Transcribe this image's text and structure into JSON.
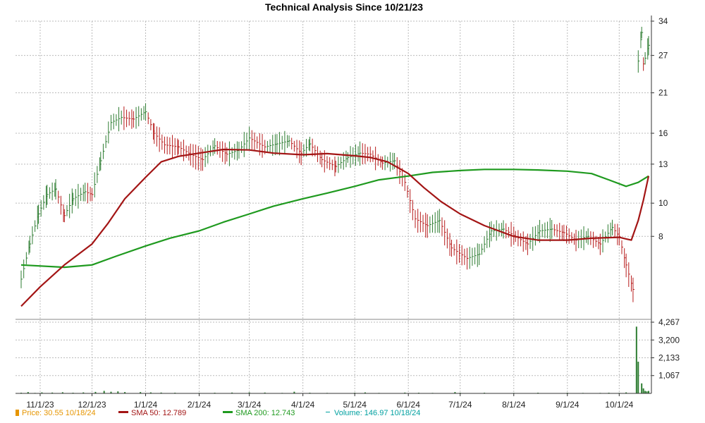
{
  "colors": {
    "price_up": "#2e7d32",
    "price_down": "#b71c1c",
    "sma50": "#a31515",
    "sma200": "#1f9a1f",
    "volume": "#2e7d32",
    "grid": "#bbbbbb",
    "legend_price": "#e69500",
    "legend_sma50": "#a31515",
    "legend_sma200": "#1f9a1f",
    "legend_volume": "#00a0a0"
  },
  "chart_data": {
    "type": "line",
    "title": "Technical Analysis Since 10/21/23",
    "x_tick_labels": [
      "11/1/23",
      "12/1/23",
      "1/1/24",
      "2/1/24",
      "3/1/24",
      "4/1/24",
      "5/1/24",
      "6/1/24",
      "7/1/24",
      "8/1/24",
      "9/1/24",
      "10/1/24"
    ],
    "x_ticks": [
      "2023-11-01",
      "2023-12-01",
      "2024-01-01",
      "2024-02-01",
      "2024-03-01",
      "2024-04-01",
      "2024-05-01",
      "2024-06-01",
      "2024-07-01",
      "2024-08-01",
      "2024-09-01",
      "2024-10-01"
    ],
    "x_range": [
      "2023-10-21",
      "2024-10-18"
    ],
    "price_axis": {
      "scale": "log",
      "ylim": [
        4.6,
        34
      ],
      "ticks": [
        8,
        10,
        13,
        16,
        21,
        27,
        34
      ],
      "position": "right"
    },
    "volume_axis": {
      "ylim": [
        0,
        4267
      ],
      "ticks": [
        1067,
        2133,
        3200,
        4267
      ],
      "tick_labels": [
        "1,067",
        "2,133",
        "3,200",
        "4,267"
      ],
      "position": "right"
    },
    "grid": true,
    "series": [
      {
        "name": "SMA 50",
        "points": [
          [
            "2023-10-21",
            5.0
          ],
          [
            "2023-11-01",
            5.7
          ],
          [
            "2023-11-15",
            6.6
          ],
          [
            "2023-12-01",
            7.6
          ],
          [
            "2023-12-10",
            8.7
          ],
          [
            "2023-12-20",
            10.3
          ],
          [
            "2024-01-01",
            11.9
          ],
          [
            "2024-01-10",
            13.2
          ],
          [
            "2024-01-20",
            13.7
          ],
          [
            "2024-02-01",
            14.0
          ],
          [
            "2024-02-15",
            14.35
          ],
          [
            "2024-03-01",
            14.3
          ],
          [
            "2024-03-15",
            14.0
          ],
          [
            "2024-04-01",
            13.85
          ],
          [
            "2024-04-15",
            13.95
          ],
          [
            "2024-05-01",
            13.75
          ],
          [
            "2024-05-10",
            13.6
          ],
          [
            "2024-05-20",
            13.2
          ],
          [
            "2024-06-01",
            12.2
          ],
          [
            "2024-06-10",
            11.1
          ],
          [
            "2024-06-20",
            10.1
          ],
          [
            "2024-07-01",
            9.3
          ],
          [
            "2024-07-15",
            8.6
          ],
          [
            "2024-08-01",
            8.0
          ],
          [
            "2024-08-15",
            7.8
          ],
          [
            "2024-09-01",
            7.8
          ],
          [
            "2024-09-15",
            7.9
          ],
          [
            "2024-10-01",
            7.95
          ],
          [
            "2024-10-08",
            7.8
          ],
          [
            "2024-10-12",
            8.9
          ],
          [
            "2024-10-15",
            10.2
          ],
          [
            "2024-10-18",
            12.0
          ]
        ]
      },
      {
        "name": "SMA 200",
        "points": [
          [
            "2023-10-21",
            6.6
          ],
          [
            "2023-11-15",
            6.5
          ],
          [
            "2023-12-01",
            6.6
          ],
          [
            "2023-12-15",
            7.0
          ],
          [
            "2024-01-01",
            7.5
          ],
          [
            "2024-01-15",
            7.9
          ],
          [
            "2024-02-01",
            8.3
          ],
          [
            "2024-02-15",
            8.8
          ],
          [
            "2024-03-01",
            9.3
          ],
          [
            "2024-03-15",
            9.8
          ],
          [
            "2024-04-01",
            10.3
          ],
          [
            "2024-04-15",
            10.7
          ],
          [
            "2024-05-01",
            11.2
          ],
          [
            "2024-05-15",
            11.7
          ],
          [
            "2024-06-01",
            12.0
          ],
          [
            "2024-06-15",
            12.3
          ],
          [
            "2024-07-01",
            12.45
          ],
          [
            "2024-07-15",
            12.55
          ],
          [
            "2024-08-01",
            12.55
          ],
          [
            "2024-08-15",
            12.5
          ],
          [
            "2024-09-01",
            12.4
          ],
          [
            "2024-09-15",
            12.2
          ],
          [
            "2024-09-25",
            11.7
          ],
          [
            "2024-10-05",
            11.2
          ],
          [
            "2024-10-12",
            11.5
          ],
          [
            "2024-10-18",
            12.0
          ]
        ]
      },
      {
        "name": "Price",
        "points": [
          [
            "2023-10-21",
            6.0
          ],
          [
            "2023-10-26",
            7.6
          ],
          [
            "2023-10-31",
            9.3
          ],
          [
            "2023-11-05",
            10.6
          ],
          [
            "2023-11-10",
            11.0
          ],
          [
            "2023-11-15",
            9.2
          ],
          [
            "2023-11-20",
            10.3
          ],
          [
            "2023-11-27",
            10.8
          ],
          [
            "2023-12-01",
            10.6
          ],
          [
            "2023-12-06",
            13.3
          ],
          [
            "2023-12-12",
            17.2
          ],
          [
            "2023-12-18",
            17.8
          ],
          [
            "2023-12-25",
            17.6
          ],
          [
            "2024-01-01",
            18.5
          ],
          [
            "2024-01-06",
            16.0
          ],
          [
            "2024-01-12",
            14.8
          ],
          [
            "2024-01-20",
            14.6
          ],
          [
            "2024-01-27",
            13.9
          ],
          [
            "2024-02-03",
            13.4
          ],
          [
            "2024-02-10",
            14.7
          ],
          [
            "2024-02-17",
            13.9
          ],
          [
            "2024-02-24",
            14.3
          ],
          [
            "2024-03-01",
            15.5
          ],
          [
            "2024-03-10",
            14.6
          ],
          [
            "2024-03-17",
            14.9
          ],
          [
            "2024-03-24",
            15.2
          ],
          [
            "2024-03-31",
            14.0
          ],
          [
            "2024-04-05",
            14.9
          ],
          [
            "2024-04-12",
            13.4
          ],
          [
            "2024-04-20",
            12.8
          ],
          [
            "2024-04-27",
            13.6
          ],
          [
            "2024-05-04",
            14.0
          ],
          [
            "2024-05-10",
            13.9
          ],
          [
            "2024-05-17",
            13.1
          ],
          [
            "2024-05-24",
            13.3
          ],
          [
            "2024-05-30",
            11.5
          ],
          [
            "2024-06-05",
            9.0
          ],
          [
            "2024-06-12",
            8.6
          ],
          [
            "2024-06-19",
            8.9
          ],
          [
            "2024-06-26",
            7.4
          ],
          [
            "2024-07-05",
            6.9
          ],
          [
            "2024-07-12",
            7.1
          ],
          [
            "2024-07-19",
            8.3
          ],
          [
            "2024-07-26",
            8.4
          ],
          [
            "2024-08-02",
            8.0
          ],
          [
            "2024-08-09",
            7.6
          ],
          [
            "2024-08-16",
            8.3
          ],
          [
            "2024-08-23",
            8.4
          ],
          [
            "2024-08-30",
            8.2
          ],
          [
            "2024-09-06",
            7.8
          ],
          [
            "2024-09-13",
            8.0
          ],
          [
            "2024-09-20",
            7.6
          ],
          [
            "2024-09-27",
            8.5
          ],
          [
            "2024-10-01",
            8.0
          ],
          [
            "2024-10-05",
            6.6
          ],
          [
            "2024-10-09",
            5.6
          ],
          [
            "2024-10-12",
            26.0
          ],
          [
            "2024-10-14",
            31.5
          ],
          [
            "2024-10-15",
            25.5
          ],
          [
            "2024-10-16",
            26.5
          ],
          [
            "2024-10-18",
            28.9
          ]
        ]
      }
    ],
    "volume": [
      [
        "2023-10-21",
        40
      ],
      [
        "2023-10-25",
        80
      ],
      [
        "2023-10-29",
        30
      ],
      [
        "2023-11-02",
        60
      ],
      [
        "2023-11-08",
        50
      ],
      [
        "2023-11-14",
        70
      ],
      [
        "2023-11-20",
        40
      ],
      [
        "2023-11-26",
        60
      ],
      [
        "2023-12-03",
        90
      ],
      [
        "2023-12-08",
        150
      ],
      [
        "2023-12-12",
        100
      ],
      [
        "2023-12-16",
        120
      ],
      [
        "2023-12-20",
        80
      ],
      [
        "2023-12-29",
        80
      ],
      [
        "2024-01-04",
        60
      ],
      [
        "2024-01-10",
        50
      ],
      [
        "2024-01-18",
        40
      ],
      [
        "2024-02-01",
        30
      ],
      [
        "2024-02-10",
        40
      ],
      [
        "2024-02-20",
        50
      ],
      [
        "2024-03-01",
        60
      ],
      [
        "2024-03-10",
        50
      ],
      [
        "2024-03-20",
        30
      ],
      [
        "2024-03-27",
        100
      ],
      [
        "2024-04-05",
        40
      ],
      [
        "2024-04-15",
        30
      ],
      [
        "2024-05-01",
        40
      ],
      [
        "2024-05-07",
        60
      ],
      [
        "2024-05-15",
        30
      ],
      [
        "2024-05-30",
        50
      ],
      [
        "2024-06-07",
        40
      ],
      [
        "2024-06-15",
        30
      ],
      [
        "2024-06-28",
        80
      ],
      [
        "2024-07-01",
        40
      ],
      [
        "2024-07-15",
        40
      ],
      [
        "2024-08-01",
        30
      ],
      [
        "2024-08-15",
        40
      ],
      [
        "2024-09-01",
        40
      ],
      [
        "2024-09-10",
        30
      ],
      [
        "2024-09-20",
        30
      ],
      [
        "2024-09-25",
        40
      ],
      [
        "2024-10-01",
        30
      ],
      [
        "2024-10-05",
        60
      ],
      [
        "2024-10-11",
        4000
      ],
      [
        "2024-10-12",
        1900
      ],
      [
        "2024-10-14",
        600
      ],
      [
        "2024-10-15",
        300
      ],
      [
        "2024-10-16",
        150
      ],
      [
        "2024-10-17",
        120
      ],
      [
        "2024-10-18",
        147
      ]
    ]
  },
  "legend": [
    {
      "key": "price",
      "label": "Price: 30.55  10/18/24"
    },
    {
      "key": "sma50",
      "label": "SMA 50: 12.789"
    },
    {
      "key": "sma200",
      "label": "SMA 200: 12.743"
    },
    {
      "key": "volume",
      "label": "Volume: 146.97  10/18/24"
    }
  ]
}
